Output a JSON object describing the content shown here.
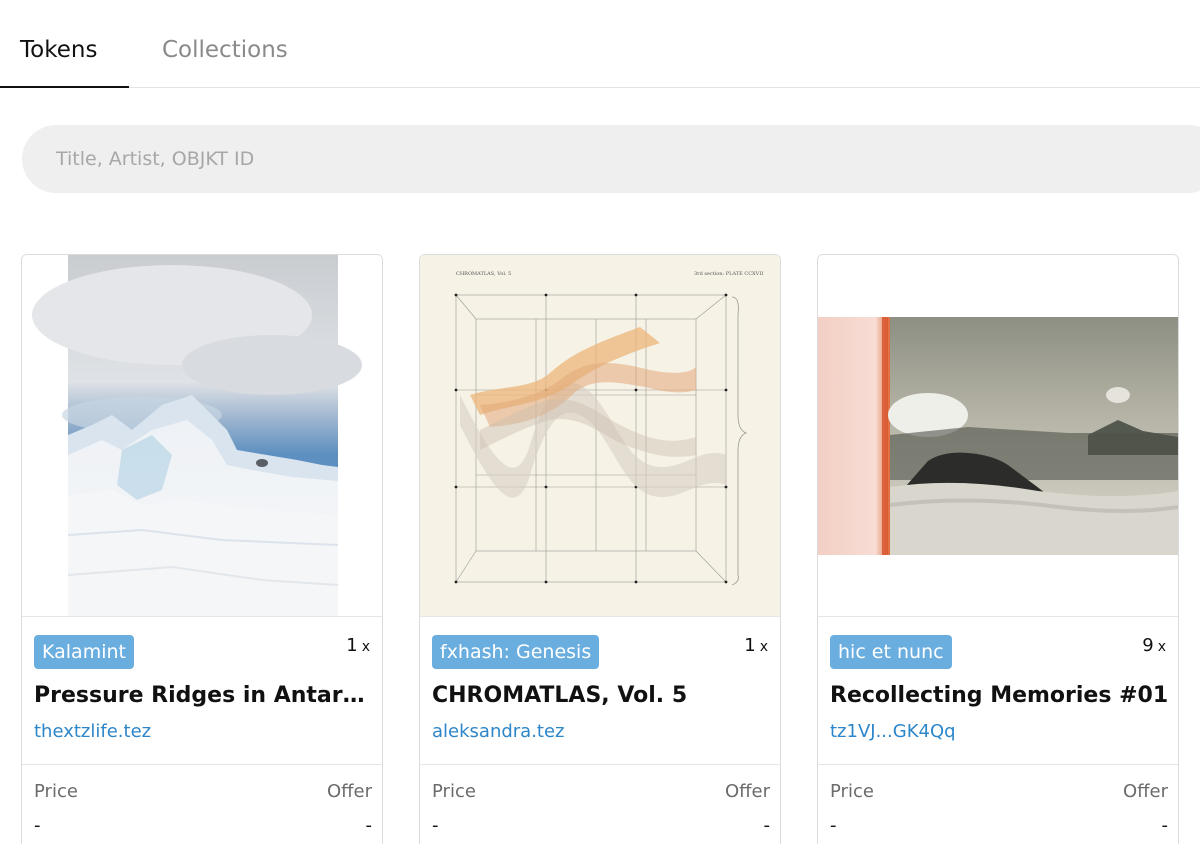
{
  "tabs": [
    {
      "label": "Tokens",
      "active": true
    },
    {
      "label": "Collections",
      "active": false
    }
  ],
  "search": {
    "placeholder": "Title, Artist, OBJKT ID",
    "value": ""
  },
  "price_label": "Price",
  "offer_label": "Offer",
  "cards": [
    {
      "platform": "Kalamint",
      "editions": "1",
      "editions_suffix": "x",
      "title": "Pressure Ridges in Antarctica",
      "artist": "thextzlife.tez",
      "price": "-",
      "offer": "-"
    },
    {
      "platform": "fxhash: Genesis",
      "editions": "1",
      "editions_suffix": "x",
      "title": "CHROMATLAS, Vol. 5",
      "artist": "aleksandra.tez",
      "price": "-",
      "offer": "-",
      "image_header_left": "CHROMATLAS, Vol. 5",
      "image_header_right": "3rd section: PLATE CCXVII"
    },
    {
      "platform": "hic et nunc",
      "editions": "9",
      "editions_suffix": "x",
      "title": "Recollecting Memories #01",
      "artist": "tz1VJ...GK4Qq",
      "price": "-",
      "offer": "-"
    }
  ],
  "colors": {
    "badge": "#6aaee0",
    "link": "#2d86c9",
    "search_bg": "#efefef"
  }
}
